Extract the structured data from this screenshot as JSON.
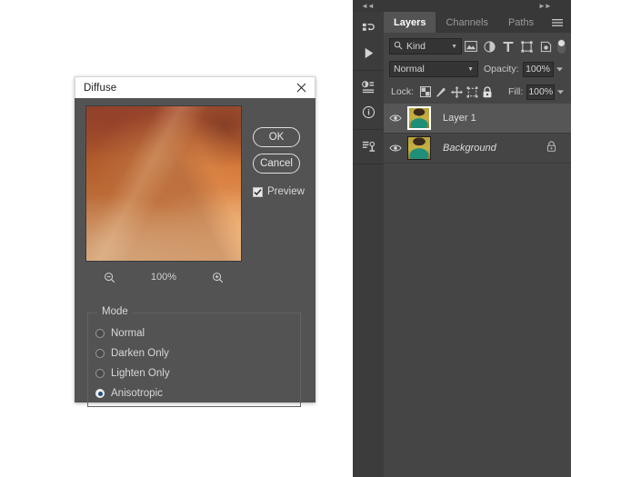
{
  "dialog": {
    "title": "Diffuse",
    "close_icon": "close-icon",
    "ok_label": "OK",
    "cancel_label": "Cancel",
    "preview_label": "Preview",
    "preview_checked": true,
    "zoom_value": "100%",
    "zoom_out_icon": "zoom-out-icon",
    "zoom_in_icon": "zoom-in-icon",
    "mode": {
      "legend": "Mode",
      "selected": "Anisotropic",
      "options": [
        {
          "label": "Normal",
          "selected": false
        },
        {
          "label": "Darken Only",
          "selected": false
        },
        {
          "label": "Lighten Only",
          "selected": false
        },
        {
          "label": "Anisotropic",
          "selected": true
        }
      ]
    }
  },
  "dock": {
    "collapse_left_icon": "chevron-double-left-icon",
    "collapse_right_icon": "chevron-double-right-icon",
    "rail_icons": [
      {
        "name": "history-icon"
      },
      {
        "name": "actions-play-icon"
      },
      {
        "name": "adjustments-icon"
      },
      {
        "name": "info-icon"
      },
      {
        "name": "properties-icon"
      }
    ],
    "tabs": [
      {
        "label": "Layers",
        "active": true
      },
      {
        "label": "Channels",
        "active": false
      },
      {
        "label": "Paths",
        "active": false
      }
    ],
    "panel_menu_icon": "panel-menu-icon",
    "filter": {
      "search_icon": "search-icon",
      "kind_label": "Kind",
      "icons": [
        "filter-pixel-icon",
        "filter-adjustment-icon",
        "filter-type-icon",
        "filter-shape-icon",
        "filter-smart-object-icon"
      ],
      "toggle_name": "filter-enable-toggle"
    },
    "blend": {
      "mode_value": "Normal",
      "opacity_label": "Opacity:",
      "opacity_value": "100%"
    },
    "lock": {
      "label": "Lock:",
      "icons": [
        "lock-transparent-pixels-icon",
        "lock-image-pixels-icon",
        "lock-position-icon",
        "lock-artboard-nesting-icon",
        "lock-all-icon"
      ],
      "fill_label": "Fill:",
      "fill_value": "100%"
    },
    "layers": [
      {
        "name": "Layer 1",
        "selected": true,
        "italic": false,
        "locked": false,
        "visible": true,
        "eye_icon": "eye-icon",
        "thumbnail_name": "layer-thumbnail"
      },
      {
        "name": "Background",
        "selected": false,
        "italic": true,
        "locked": true,
        "visible": true,
        "eye_icon": "eye-icon",
        "lock_icon": "padlock-icon",
        "thumbnail_name": "layer-thumbnail"
      }
    ]
  },
  "colors": {
    "dialog_bg": "#535353",
    "titlebar_bg": "#ffffff",
    "panel_bg": "#454545",
    "tabbar_bg": "#383838",
    "rail_bg": "#3c3c3c",
    "selected_row": "#565656",
    "radio_accent": "#1f4f86"
  }
}
